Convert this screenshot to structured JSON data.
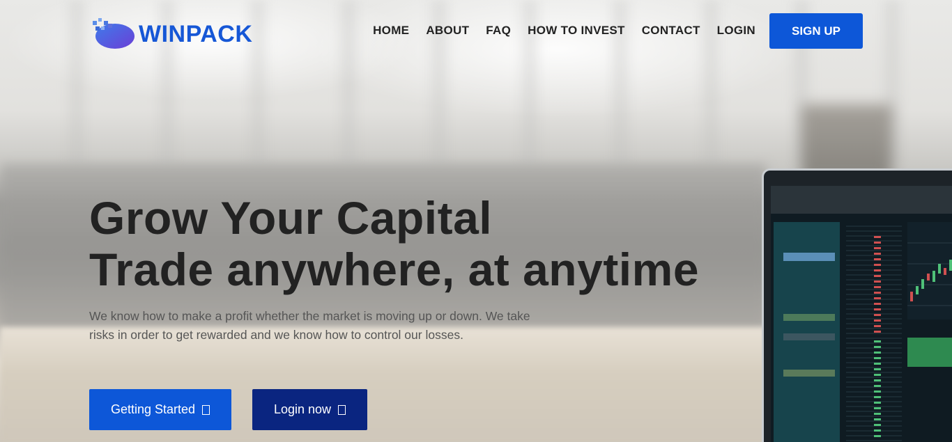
{
  "brand": {
    "name": "WINPACK",
    "color": "#1657d6"
  },
  "nav": {
    "items": [
      "HOME",
      "ABOUT",
      "FAQ",
      "HOW TO INVEST",
      "CONTACT",
      "LOGIN"
    ],
    "signup_label": "SIGN UP"
  },
  "hero": {
    "title_line1": "Grow Your Capital",
    "title_line2": "Trade anywhere, at anytime",
    "subtitle": "We know how to make a profit whether the market is moving up or down. We take risks in order to get rewarded and we know how to control our losses.",
    "primary_button": "Getting Started",
    "secondary_button": "Login now",
    "button_icon": "box-glyph-icon"
  },
  "colors": {
    "primary": "#0d57d8",
    "secondary": "#0a2580",
    "text_dark": "#222222"
  }
}
